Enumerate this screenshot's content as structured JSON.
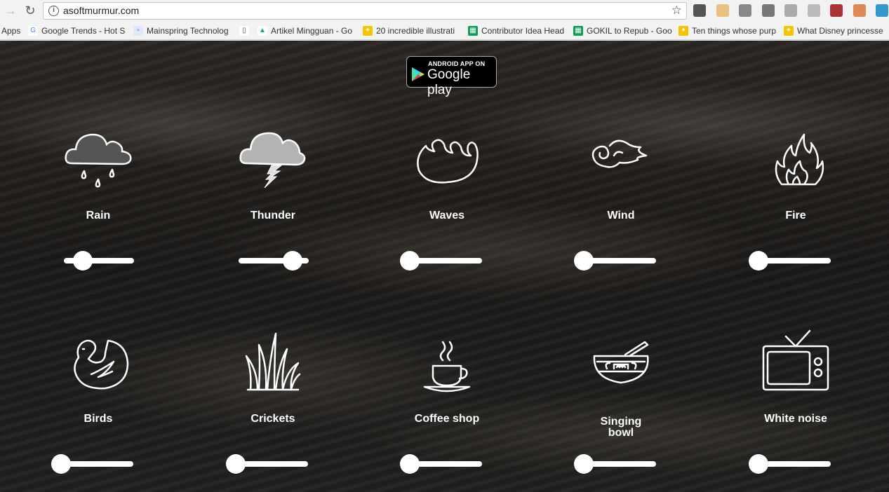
{
  "browser": {
    "url": "asoftmurmur.com",
    "extensions": [
      "youtube-icon",
      "puzzle-face-icon",
      "dart-icon",
      "clock-icon",
      "cloud-icon",
      "drive-icon",
      "chevrons-icon",
      "fire-face-icon",
      "chat-icon"
    ]
  },
  "bookmarks": [
    {
      "label": "Apps",
      "icon": "apps-icon"
    },
    {
      "label": "Google Trends - Hot S",
      "icon": "google-icon"
    },
    {
      "label": "Mainspring Technolog",
      "icon": "squares-icon"
    },
    {
      "label": "",
      "icon": "page-icon"
    },
    {
      "label": "Artikel Mingguan - Go",
      "icon": "drive-icon"
    },
    {
      "label": "20 incredible illustrati",
      "icon": "lightbulb-icon"
    },
    {
      "label": "Contributor Idea Head",
      "icon": "sheets-icon"
    },
    {
      "label": "GOKIL to Repub - Goo",
      "icon": "sheets-icon"
    },
    {
      "label": "Ten things whose purp",
      "icon": "lightbulb-icon"
    },
    {
      "label": "What Disney princesse",
      "icon": "lightbulb-icon"
    }
  ],
  "badge": {
    "line1": "ANDROID APP ON",
    "line2": "Google play"
  },
  "sounds": [
    {
      "label": "Rain",
      "icon": "rain-cloud",
      "volume": 0.27,
      "active": true
    },
    {
      "label": "Thunder",
      "icon": "thunder-cloud",
      "volume": 0.77,
      "active": true
    },
    {
      "label": "Waves",
      "icon": "waves",
      "volume": 0,
      "active": false
    },
    {
      "label": "Wind",
      "icon": "wind",
      "volume": 0,
      "active": false
    },
    {
      "label": "Fire",
      "icon": "fire",
      "volume": 0,
      "active": false
    },
    {
      "label": "Birds",
      "icon": "bird",
      "volume": 0,
      "active": false
    },
    {
      "label": "Crickets",
      "icon": "grass",
      "volume": 0,
      "active": false
    },
    {
      "label": "Coffee shop",
      "icon": "coffee-cup",
      "volume": 0,
      "active": false
    },
    {
      "label": "Singing bowl",
      "icon": "singing-bowl",
      "volume": 0,
      "active": false
    },
    {
      "label": "White noise",
      "icon": "tv",
      "volume": 0,
      "active": false
    }
  ]
}
